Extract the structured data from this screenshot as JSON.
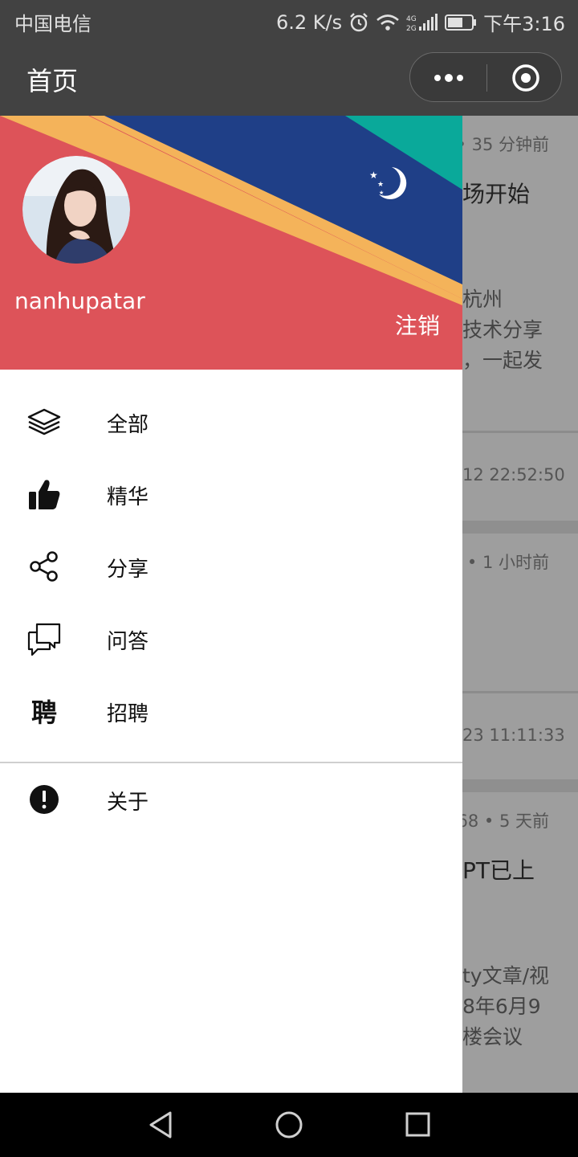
{
  "status_bar": {
    "carrier": "中国电信",
    "speed": "6.2 K/s",
    "network": "4G 2G",
    "time": "下午3:16"
  },
  "nav": {
    "title": "首页"
  },
  "drawer": {
    "username": "nanhupatar",
    "logout_label": "注销",
    "menu": [
      {
        "label": "全部",
        "icon": "layers-icon"
      },
      {
        "label": "精华",
        "icon": "thumbs-up-icon"
      },
      {
        "label": "分享",
        "icon": "share-icon"
      },
      {
        "label": "问答",
        "icon": "chat-bubbles-icon"
      },
      {
        "label": "招聘",
        "icon": "recruit-icon"
      }
    ],
    "about": {
      "label": "关于",
      "icon": "info-icon"
    }
  },
  "feed": {
    "cards": [
      {
        "meta": "• 35 分钟前",
        "title": "场开始",
        "body": [
          "杭州",
          "技术分享",
          "，一起发"
        ]
      },
      {
        "time": "12 22:52:50"
      },
      {
        "meta": "• 1 小时前"
      },
      {
        "time": "23 11:11:33"
      },
      {
        "meta": "68 • 5 天前",
        "title": "PT已上",
        "body": [
          "ty文章/视",
          "8年6月9",
          "楼会议"
        ]
      }
    ]
  },
  "colors": {
    "header_red": "#dd5359",
    "header_blue": "#1f3f87",
    "header_teal": "#0aa99a",
    "header_yellow": "#f4b35a",
    "bar_dark": "#424242"
  }
}
